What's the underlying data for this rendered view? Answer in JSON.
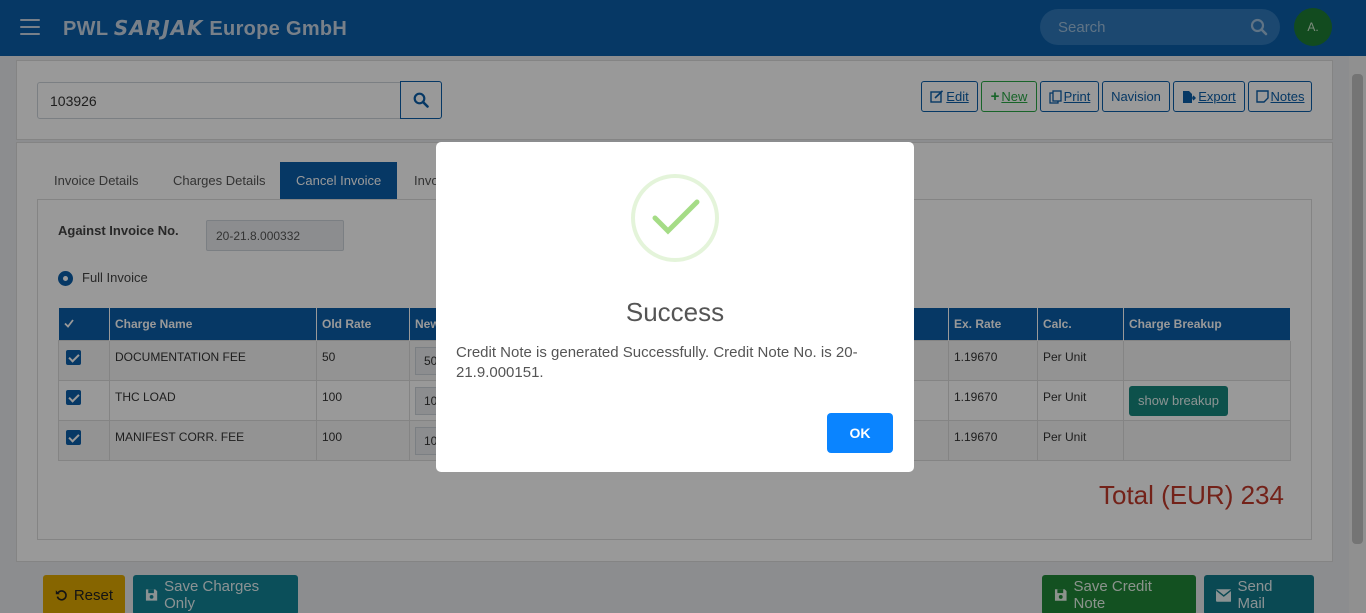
{
  "header": {
    "brand_prefix": "PWL",
    "brand_sarjak": "SARJAK",
    "brand_suffix": "Europe GmbH",
    "search_placeholder": "Search",
    "avatar_initial": "A."
  },
  "search_panel": {
    "invoice_value": "103926"
  },
  "toolbar": {
    "edit": "Edit",
    "new": "New",
    "print": "Print",
    "navision": "Navision",
    "export": "Export",
    "notes": "Notes"
  },
  "tabs": [
    {
      "label": "Invoice Details"
    },
    {
      "label": "Charges Details"
    },
    {
      "label": "Cancel Invoice"
    },
    {
      "label": "Invo"
    }
  ],
  "form": {
    "against_label": "Against Invoice No.",
    "against_value": "20-21.8.000332",
    "full_invoice_label": "Full Invoice"
  },
  "table": {
    "headers": [
      "Charge Name",
      "Old Rate",
      "New",
      "Ex. Rate",
      "Calc.",
      "Charge Breakup"
    ],
    "rows": [
      {
        "name": "DOCUMENTATION FEE",
        "old_rate": "50",
        "new_rate": "50",
        "ex_rate": "1.19670",
        "calc": "Per Unit",
        "breakup": ""
      },
      {
        "name": "THC LOAD",
        "old_rate": "100",
        "new_rate": "10",
        "ex_rate": "1.19670",
        "calc": "Per Unit",
        "breakup": "show breakup"
      },
      {
        "name": "MANIFEST CORR. FEE",
        "old_rate": "100",
        "new_rate": "10",
        "ex_rate": "1.19670",
        "calc": "Per Unit",
        "breakup": ""
      }
    ]
  },
  "total": "Total (EUR) 234",
  "buttons": {
    "reset": "Reset",
    "save_charges": "Save Charges Only",
    "save_credit": "Save Credit Note",
    "send_mail": "Send Mail"
  },
  "modal": {
    "title": "Success",
    "message": "Credit Note is generated Successfully. Credit Note No. is 20-21.9.000151.",
    "ok": "OK"
  },
  "colors": {
    "primary": "#0b5ea8",
    "success_check": "#a5dc86",
    "ok_button": "#0a84ff",
    "total_text": "#c0392b"
  }
}
